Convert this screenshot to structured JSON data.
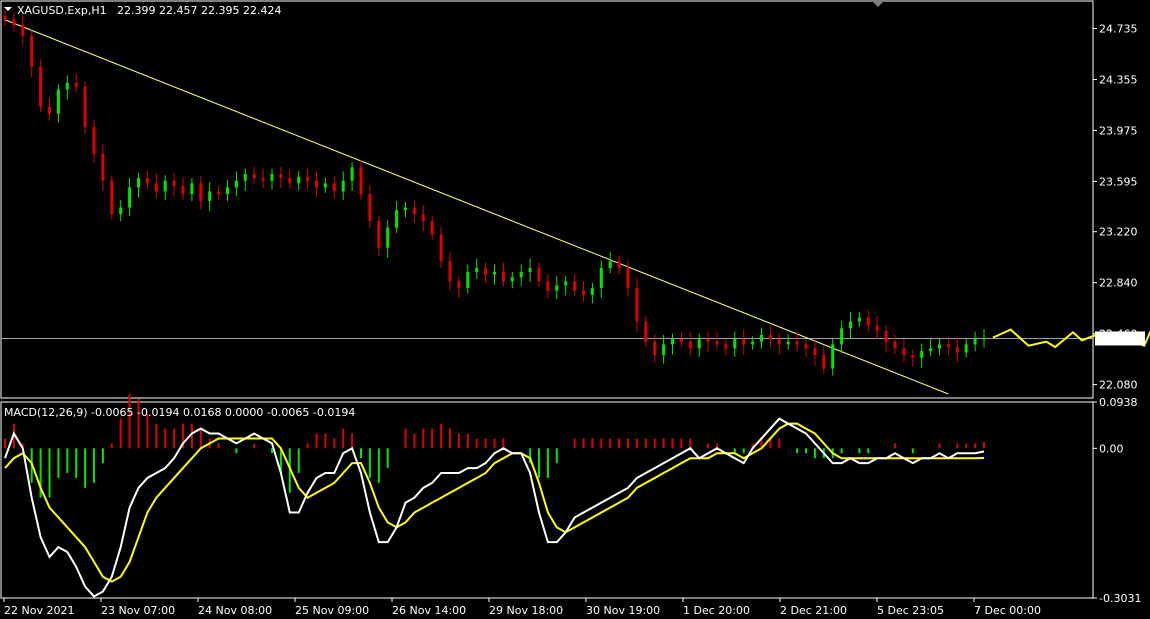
{
  "header": {
    "symbol": "XAGUSD.Exp,H1",
    "ohlc": "22.399 22.457 22.395 22.424"
  },
  "colors": {
    "background": "#000000",
    "frame": "#ffffff",
    "bull": "#00e600",
    "bear": "#e00000",
    "trendline": "#ffff66",
    "forecast": "#ffff00",
    "price_line": "#9aa0a6",
    "macd_line": "#ffffff",
    "signal_line": "#ffff00"
  },
  "price_axis": {
    "ticks": [
      "24.735",
      "24.355",
      "23.975",
      "23.595",
      "23.220",
      "22.840",
      "22.460",
      "22.080"
    ],
    "current": "22.424"
  },
  "time_axis": {
    "labels": [
      "22 Nov 2021",
      "23 Nov 07:00",
      "24 Nov 08:00",
      "25 Nov 09:00",
      "26 Nov 14:00",
      "29 Nov 18:00",
      "30 Nov 19:00",
      "1 Dec 20:00",
      "2 Dec 21:00",
      "5 Dec 23:05",
      "7 Dec 00:00"
    ]
  },
  "indicator": {
    "title": "MACD(12,26,9) -0.0065 -0.0194 0.0168 0.0000 -0.0065 -0.0194",
    "ticks": [
      "0.0938",
      "0.00",
      "-0.3031"
    ]
  },
  "chart_data": [
    {
      "type": "candlestick",
      "title": "XAGUSD.Exp,H1",
      "ylim": [
        21.98,
        24.94
      ],
      "current_price": 22.424,
      "trendline": [
        [
          0,
          24.8
        ],
        [
          106,
          22.01
        ]
      ],
      "forecast_path": [
        [
          111,
          22.43
        ],
        [
          113,
          22.49
        ],
        [
          115,
          22.37
        ],
        [
          117,
          22.4
        ],
        [
          118,
          22.36
        ],
        [
          120,
          22.47
        ],
        [
          121,
          22.41
        ],
        [
          123,
          22.46
        ],
        [
          125,
          22.38
        ],
        [
          127,
          22.4
        ],
        [
          128,
          22.37
        ],
        [
          129,
          22.52
        ],
        [
          130,
          22.63
        ],
        [
          131,
          22.84
        ]
      ],
      "closes": [
        24.8,
        24.76,
        24.68,
        24.45,
        24.15,
        24.1,
        24.28,
        24.33,
        24.3,
        24.0,
        23.8,
        23.6,
        23.35,
        23.4,
        23.55,
        23.62,
        23.58,
        23.52,
        23.6,
        23.56,
        23.5,
        23.58,
        23.45,
        23.52,
        23.5,
        23.55,
        23.6,
        23.65,
        23.62,
        23.6,
        23.65,
        23.62,
        23.58,
        23.63,
        23.6,
        23.55,
        23.58,
        23.52,
        23.6,
        23.7,
        23.5,
        23.3,
        23.1,
        23.25,
        23.38,
        23.4,
        23.35,
        23.3,
        23.2,
        23.0,
        22.85,
        22.8,
        22.92,
        22.95,
        22.9,
        22.92,
        22.85,
        22.88,
        22.92,
        22.95,
        22.85,
        22.78,
        22.82,
        22.85,
        22.78,
        22.75,
        22.8,
        22.95,
        23.0,
        22.95,
        22.8,
        22.55,
        22.4,
        22.3,
        22.38,
        22.42,
        22.4,
        22.35,
        22.42,
        22.4,
        22.38,
        22.35,
        22.42,
        22.38,
        22.4,
        22.45,
        22.42,
        22.38,
        22.4,
        22.38,
        22.35,
        22.3,
        22.2,
        22.38,
        22.5,
        22.55,
        22.58,
        22.52,
        22.48,
        22.4,
        22.35,
        22.3,
        22.28,
        22.33,
        22.35,
        22.38,
        22.36,
        22.32,
        22.38,
        22.42,
        22.424
      ]
    },
    {
      "type": "line",
      "title": "MACD(12,26,9)",
      "ylim": [
        -0.3031,
        0.0938
      ],
      "series": [
        {
          "name": "MACD",
          "values": [
            -0.02,
            0.03,
            0.0,
            -0.1,
            -0.18,
            -0.22,
            -0.2,
            -0.21,
            -0.24,
            -0.28,
            -0.3,
            -0.29,
            -0.26,
            -0.2,
            -0.12,
            -0.08,
            -0.06,
            -0.05,
            -0.04,
            -0.02,
            0.01,
            0.03,
            0.04,
            0.03,
            0.03,
            0.02,
            0.01,
            0.02,
            0.03,
            0.02,
            0.01,
            -0.05,
            -0.13,
            -0.13,
            -0.09,
            -0.06,
            -0.05,
            -0.05,
            -0.01,
            0.0,
            -0.05,
            -0.13,
            -0.19,
            -0.19,
            -0.16,
            -0.11,
            -0.1,
            -0.08,
            -0.07,
            -0.05,
            -0.05,
            -0.05,
            -0.04,
            -0.04,
            -0.03,
            -0.01,
            0.0,
            -0.01,
            -0.01,
            -0.05,
            -0.13,
            -0.19,
            -0.19,
            -0.17,
            -0.14,
            -0.13,
            -0.12,
            -0.11,
            -0.1,
            -0.09,
            -0.08,
            -0.06,
            -0.05,
            -0.04,
            -0.03,
            -0.02,
            -0.01,
            0.0,
            -0.02,
            -0.01,
            0.0,
            -0.01,
            -0.02,
            -0.03,
            0.0,
            0.02,
            0.04,
            0.06,
            0.05,
            0.04,
            0.03,
            0.01,
            -0.01,
            -0.03,
            -0.03,
            -0.02,
            -0.03,
            -0.03,
            -0.02,
            -0.02,
            -0.01,
            -0.02,
            -0.03,
            -0.02,
            -0.02,
            -0.01,
            -0.02,
            -0.01,
            -0.01,
            -0.01,
            -0.0065
          ]
        },
        {
          "name": "Signal",
          "values": [
            -0.04,
            -0.02,
            -0.01,
            -0.03,
            -0.08,
            -0.12,
            -0.14,
            -0.16,
            -0.18,
            -0.2,
            -0.23,
            -0.26,
            -0.27,
            -0.26,
            -0.23,
            -0.18,
            -0.13,
            -0.1,
            -0.08,
            -0.06,
            -0.04,
            -0.02,
            0.0,
            0.01,
            0.02,
            0.02,
            0.02,
            0.02,
            0.02,
            0.02,
            0.02,
            0.0,
            -0.04,
            -0.08,
            -0.1,
            -0.09,
            -0.08,
            -0.07,
            -0.05,
            -0.03,
            -0.03,
            -0.07,
            -0.12,
            -0.15,
            -0.16,
            -0.15,
            -0.13,
            -0.12,
            -0.11,
            -0.1,
            -0.09,
            -0.08,
            -0.07,
            -0.06,
            -0.05,
            -0.03,
            -0.02,
            -0.01,
            -0.01,
            -0.02,
            -0.07,
            -0.13,
            -0.16,
            -0.17,
            -0.16,
            -0.15,
            -0.14,
            -0.13,
            -0.12,
            -0.11,
            -0.1,
            -0.08,
            -0.07,
            -0.06,
            -0.05,
            -0.04,
            -0.03,
            -0.02,
            -0.02,
            -0.02,
            -0.01,
            -0.01,
            -0.01,
            -0.02,
            -0.01,
            0.0,
            0.02,
            0.04,
            0.05,
            0.05,
            0.04,
            0.03,
            0.01,
            -0.01,
            -0.02,
            -0.02,
            -0.02,
            -0.02,
            -0.02,
            -0.02,
            -0.02,
            -0.02,
            -0.02,
            -0.02,
            -0.02,
            -0.02,
            -0.02,
            -0.02,
            -0.02,
            -0.02,
            -0.0194
          ]
        }
      ]
    }
  ]
}
